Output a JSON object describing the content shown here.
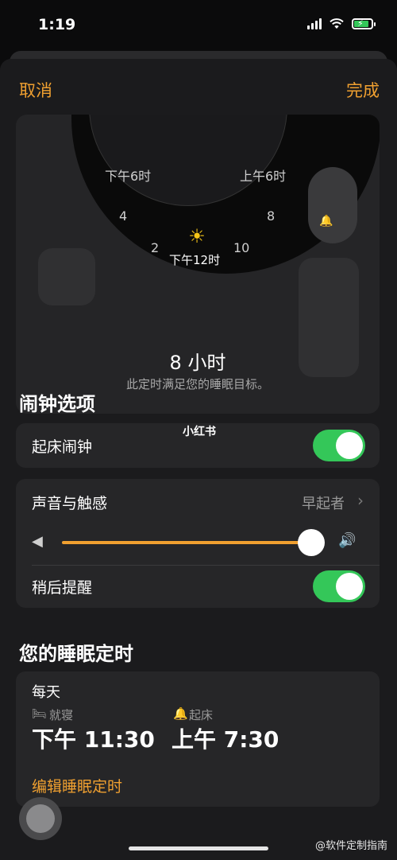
{
  "status_bar": {
    "time": "1:19"
  },
  "nav": {
    "cancel": "取消",
    "done": "完成"
  },
  "dial": {
    "top_left_label": "下午6时",
    "top_right_label": "上午6时",
    "numbers": {
      "left4": "4",
      "right8": "8",
      "left2": "2",
      "right10": "10"
    },
    "bottom_label": "下午12时",
    "duration": "8 小时",
    "duration_note": "此定时满足您的睡眠目标。"
  },
  "alarm_options": {
    "title": "闹钟选项",
    "wake_alarm_label": "起床闹钟",
    "wake_alarm_on": true,
    "sound_label": "声音与触感",
    "sound_value": "早起者",
    "volume_fraction": 0.95,
    "snooze_label": "稍后提醒",
    "snooze_on": true
  },
  "schedule": {
    "title": "您的睡眠定时",
    "frequency": "每天",
    "bedtime_label": "就寝",
    "bedtime": "下午 11:30",
    "wake_label": "起床",
    "wake": "上午 7:30",
    "edit_label": "编辑睡眠定时"
  },
  "watermarks": {
    "top": "小红书",
    "bottom": "@软件定制指南"
  },
  "colors": {
    "accent": "#f0a030",
    "toggle_on": "#34c759",
    "background": "#1b1b1d"
  }
}
